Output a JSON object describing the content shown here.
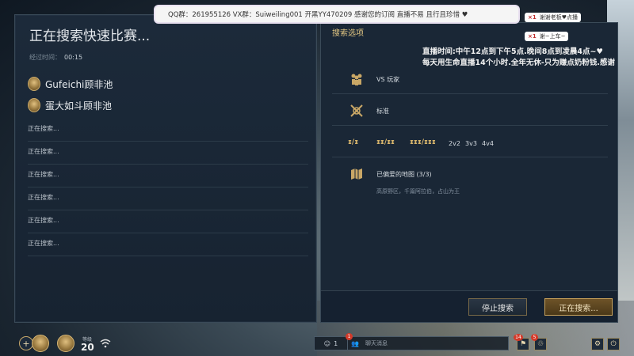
{
  "left": {
    "title": "正在搜索快速比赛...",
    "timer_label": "经过时间：",
    "timer_value": "00:15",
    "players": [
      {
        "name": "Gufeichi顾非池"
      },
      {
        "name": "蛋大如斗顾非池"
      }
    ],
    "slots": [
      "正在搜索...",
      "正在搜索...",
      "正在搜索...",
      "正在搜索...",
      "正在搜索...",
      "正在搜索..."
    ]
  },
  "right": {
    "title": "搜索选项",
    "stream_note_1": "直播时间:中午12点到下午5点.晚间8点到凌晨4点~♥",
    "stream_note_2": "每天用生命直播14个小时.全年无休-只为赚点奶粉钱.感谢",
    "options": {
      "opponent": "VS 玩家",
      "mode": "标准",
      "team_sizes": [
        "2v2",
        "3v3",
        "4v4"
      ],
      "maps_label": "已偏爱的地图 (3/3)",
      "maps_desc": "高原野区，千篇阿拉伯，占山为王"
    },
    "buttons": {
      "stop": "停止搜索",
      "searching": "正在搜索..."
    }
  },
  "overlay": {
    "qq_banner": "QQ群：261955126 VX群：Suiweiling001 开黑YY470209 感谢您的订阅 直播不易 且行且珍惜 ♥",
    "sticker_1_x": "×1",
    "sticker_1_text": "谢谢老板♥点播",
    "sticker_2_x": "×1",
    "sticker_2_text": "谢~上车~"
  },
  "bottom": {
    "add_icon": "+",
    "level_label": "等级",
    "level_value": "20",
    "chat_friends": "1",
    "chat_placeholder": "聊天消息",
    "badge_chat": "1",
    "badge_notif": "14",
    "badge_social": "5"
  },
  "colors": {
    "gold": "#c9a25a",
    "panel": "#1a2736",
    "accent_text": "#e3c783"
  }
}
